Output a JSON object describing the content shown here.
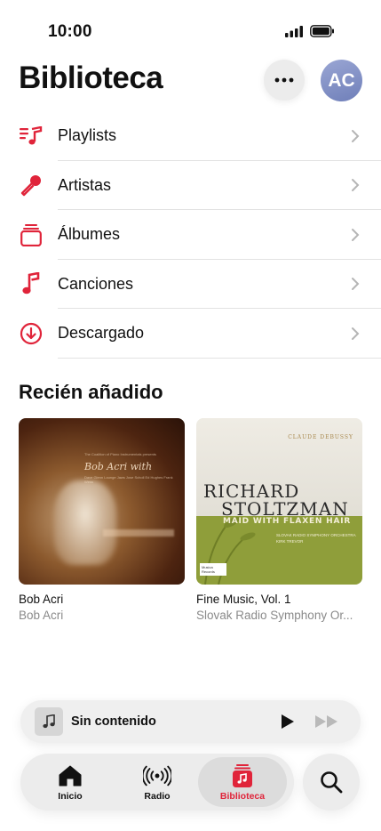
{
  "status_bar": {
    "time": "10:00",
    "icons": [
      "signal-icon",
      "battery-icon"
    ]
  },
  "header": {
    "title": "Biblioteca",
    "more_icon": "ellipsis-icon",
    "avatar_initials": "AC"
  },
  "library": {
    "items": [
      {
        "label": "Playlists",
        "icon": "playlist-icon"
      },
      {
        "label": "Artistas",
        "icon": "microphone-icon"
      },
      {
        "label": "Álbumes",
        "icon": "album-stack-icon"
      },
      {
        "label": "Canciones",
        "icon": "music-note-icon"
      },
      {
        "label": "Descargado",
        "icon": "download-circle-icon"
      }
    ]
  },
  "recent": {
    "title": "Recién añadido",
    "albums": [
      {
        "title": "Bob Acri",
        "artist": "Bob Acri",
        "cover_text": "Bob Acri with",
        "cover_small": "The Coalition of Piano Instrumentals presents",
        "cover_sub": "Dave Glenn Lounge Jaws Jose Scholl Ed Hughes Frank Wess"
      },
      {
        "title": "Fine Music, Vol. 1",
        "artist": "Slovak Radio Symphony Or...",
        "cover_composer": "CLAUDE DEBUSSY",
        "cover_name_1": "RICHARD",
        "cover_name_2": "STOLTZMAN",
        "cover_piece": "MAID WITH FLAXEN HAIR",
        "cover_orchestra": "SLOVAK RADIO SYMPHONY ORCHESTRA",
        "cover_conductor": "KIRK TREVOR",
        "cover_label": "Musica Records"
      }
    ]
  },
  "mini_player": {
    "title": "Sin contenido",
    "art_icon": "music-note-icon",
    "play_icon": "play-icon",
    "forward_icon": "forward-icon"
  },
  "tab_bar": {
    "tabs": [
      {
        "label": "Inicio",
        "icon": "home-icon",
        "active": false
      },
      {
        "label": "Radio",
        "icon": "radio-waves-icon",
        "active": false
      },
      {
        "label": "Biblioteca",
        "icon": "library-icon",
        "active": true
      }
    ],
    "search_icon": "search-icon"
  },
  "colors": {
    "accent": "#e0243a",
    "chevron": "#b5b5b5",
    "secondary_text": "#8a8a8a",
    "avatar": "#7f8dc4"
  }
}
